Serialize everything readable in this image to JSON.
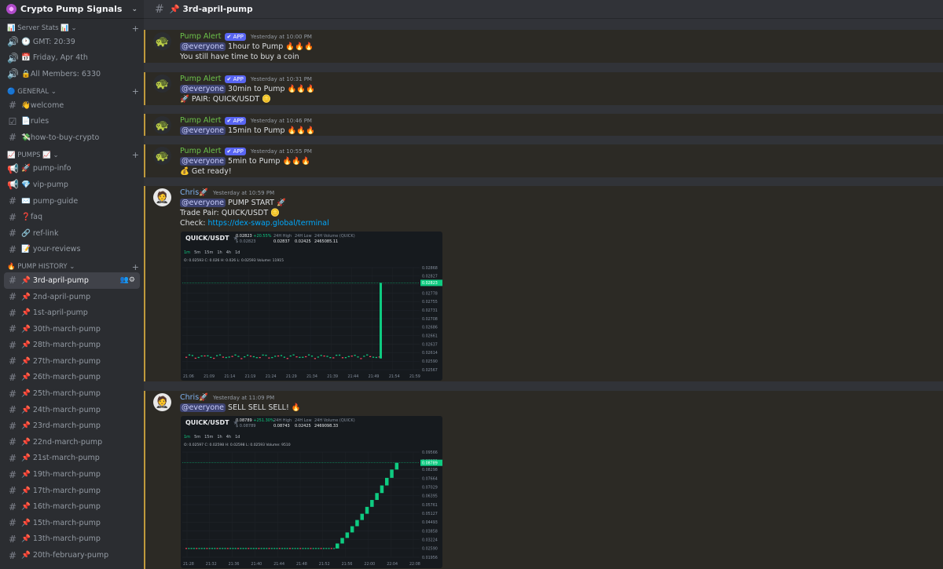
{
  "server": {
    "name": "Crypto Pump Signals"
  },
  "sidebar": {
    "categories": [
      {
        "label": "📊 Server Stats 📊",
        "top": 30,
        "channels": [
          {
            "icon": "speaker-icon",
            "label": "🕐 GMT: 20:39"
          },
          {
            "icon": "speaker-icon",
            "label": "📅 Friday, Apr 4th"
          },
          {
            "icon": "speaker-icon",
            "label": "🔒All Members: 6330"
          }
        ]
      },
      {
        "label": "🔵 GENERAL",
        "channels": [
          {
            "icon": "hash",
            "label": "👋welcome"
          },
          {
            "icon": "rules",
            "label": "📄rules"
          },
          {
            "icon": "hash",
            "label": "💸how-to-buy-crypto"
          }
        ]
      },
      {
        "label": "📈 PUMPS 📈",
        "channels": [
          {
            "icon": "announce",
            "label": "🚀 pump-info"
          },
          {
            "icon": "announce",
            "label": "💎 vip-pump"
          },
          {
            "icon": "hash",
            "label": "✉️ pump-guide"
          },
          {
            "icon": "hash",
            "label": "❓faq"
          },
          {
            "icon": "hash",
            "label": "🔗 ref-link"
          },
          {
            "icon": "hash",
            "label": "📝 your-reviews"
          }
        ]
      },
      {
        "label": "🔥 PUMP HISTORY",
        "channels": [
          {
            "icon": "hash",
            "label": "📌 3rd-april-pump",
            "active": true
          },
          {
            "icon": "hash",
            "label": "📌 2nd-april-pump"
          },
          {
            "icon": "hash",
            "label": "📌 1st-april-pump"
          },
          {
            "icon": "hash",
            "label": "📌 30th-march-pump"
          },
          {
            "icon": "hash",
            "label": "📌 28th-march-pump"
          },
          {
            "icon": "hash",
            "label": "📌 27th-march-pump"
          },
          {
            "icon": "hash",
            "label": "📌 26th-march-pump"
          },
          {
            "icon": "hash",
            "label": "📌 25th-march-pump"
          },
          {
            "icon": "hash",
            "label": "📌 24th-march-pump"
          },
          {
            "icon": "hash",
            "label": "📌 23rd-march-pump"
          },
          {
            "icon": "hash",
            "label": "📌 22nd-march-pump"
          },
          {
            "icon": "hash",
            "label": "📌 21st-march-pump"
          },
          {
            "icon": "hash",
            "label": "📌 19th-march-pump"
          },
          {
            "icon": "hash",
            "label": "📌 17th-march-pump"
          },
          {
            "icon": "hash",
            "label": "📌 16th-march-pump"
          },
          {
            "icon": "hash",
            "label": "📌 15th-march-pump"
          },
          {
            "icon": "hash",
            "label": "📌 13th-march-pump"
          },
          {
            "icon": "hash",
            "label": "📌 20th-february-pump"
          }
        ]
      }
    ]
  },
  "channel": {
    "title": "📌 3rd-april-pump"
  },
  "messages": [
    {
      "author": "Pump Alert",
      "app": "✔ APP",
      "time": "Yesterday at 10:00 PM",
      "lines": [
        [
          "@everyone",
          " 1hour to Pump 🔥🔥🔥"
        ],
        [
          "",
          "You still have time to buy a coin"
        ]
      ]
    },
    {
      "author": "Pump Alert",
      "app": "✔ APP",
      "time": "Yesterday at 10:31 PM",
      "lines": [
        [
          "@everyone",
          " 30min to Pump 🔥🔥🔥"
        ],
        [
          "",
          "🚀 PAIR: QUICK/USDT 🪙"
        ]
      ]
    },
    {
      "author": "Pump Alert",
      "app": "✔ APP",
      "time": "Yesterday at 10:46 PM",
      "lines": [
        [
          "@everyone",
          " 15min to Pump 🔥🔥🔥"
        ]
      ]
    },
    {
      "author": "Pump Alert",
      "app": "✔ APP",
      "time": "Yesterday at 10:55 PM",
      "lines": [
        [
          "@everyone",
          " 5min to Pump 🔥🔥🔥"
        ],
        [
          "",
          "💰 Get ready!"
        ]
      ]
    },
    {
      "author": "Chris",
      "badge": "🚀",
      "time": "Yesterday at 10:59 PM",
      "lines": [
        [
          "@everyone",
          " PUMP START 🚀"
        ],
        [
          "",
          "Trade Pair: QUICK/USDT 🪙"
        ],
        [
          "",
          "Check: "
        ]
      ],
      "link": "https://dex-swap.global/terminal"
    },
    {
      "author": "Chris",
      "badge": "🚀",
      "time": "Yesterday at 11:09 PM",
      "lines": [
        [
          "@everyone",
          " SELL SELL SELL! 🔥"
        ]
      ]
    }
  ],
  "charts": [
    {
      "pair": "QUICK/USDT",
      "price": "0.02823",
      "change": "+20.55%",
      "price_usd": "$ 0.02823",
      "high_label": "24H High",
      "high": "0.02837",
      "low_label": "24H Low",
      "low": "0.02425",
      "vol_label": "24H Volume (QUICK)",
      "vol": "2465085.11",
      "timeframes": [
        "1m",
        "5m",
        "15m",
        "1h",
        "4h",
        "1d"
      ],
      "ohlc": "O: 0.02593  C: 0.026  H: 0.026  L: 0.02593  Volume: 11915",
      "chart_data": {
        "type": "candlestick",
        "x_ticks": [
          "21:06",
          "21:09",
          "21:14",
          "21:19",
          "21:24",
          "21:29",
          "21:34",
          "21:39",
          "21:44",
          "21:49",
          "21:54",
          "21:59"
        ],
        "y_ticks": [
          "0.02868",
          "0.02827",
          "0.02802",
          "0.02778",
          "0.02755",
          "0.02731",
          "0.02708",
          "0.02686",
          "0.02661",
          "0.02637",
          "0.02614",
          "0.02590",
          "0.02567"
        ],
        "ylim": [
          0.02567,
          0.02868
        ],
        "current_price": 0.02823,
        "pump_candle": {
          "open": 0.026,
          "close": 0.02823
        },
        "base_level": 0.02605
      }
    },
    {
      "pair": "QUICK/USDT",
      "price": "0.08789",
      "change": "+251.30%",
      "price_usd": "$ 0.08789",
      "high_label": "24H High",
      "high": "0.08743",
      "low_label": "24H Low",
      "low": "0.02425",
      "vol_label": "24H Volume (QUICK)",
      "vol": "2469098.33",
      "timeframes": [
        "1m",
        "5m",
        "15m",
        "1h",
        "4h",
        "1d"
      ],
      "ohlc": "O: 0.02597  C: 0.02598  H: 0.02598  L: 0.02593  Volume: 9510",
      "chart_data": {
        "type": "candlestick",
        "x_ticks": [
          "21:28",
          "21:32",
          "21:36",
          "21:40",
          "21:44",
          "21:48",
          "21:52",
          "21:56",
          "22:00",
          "22:04",
          "22:08"
        ],
        "y_ticks": [
          "0.09566",
          "0.08932",
          "0.08298",
          "0.07664",
          "0.07029",
          "0.06395",
          "0.05761",
          "0.05127",
          "0.04493",
          "0.03858",
          "0.03224",
          "0.02590",
          "0.01956"
        ],
        "ylim": [
          0.01956,
          0.09566
        ],
        "current_price": 0.08789,
        "steps": [
          0.0259,
          0.0295,
          0.0335,
          0.0375,
          0.042,
          0.0465,
          0.051,
          0.056,
          0.061,
          0.066,
          0.0715,
          0.077,
          0.083,
          0.0879
        ]
      }
    }
  ]
}
